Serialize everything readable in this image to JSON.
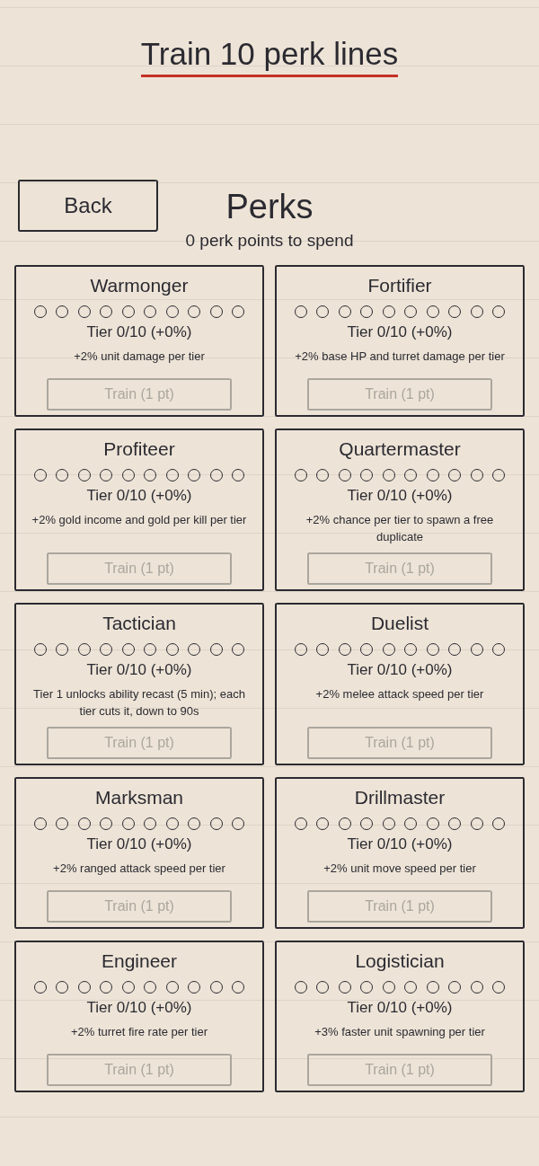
{
  "title": "Train 10 perk lines",
  "back_button": {
    "label": "Back"
  },
  "heading": "Perks",
  "points_text": "0 perk points to spend",
  "perks": [
    {
      "name": "Warmonger",
      "stars": 0,
      "tier": "Tier 0/10 (+0%)",
      "description": "+2% unit damage per tier",
      "train_button": {
        "label": "Train (1 pt)",
        "disabled": true
      }
    },
    {
      "name": "Fortifier",
      "stars": 0,
      "tier": "Tier 0/10 (+0%)",
      "description": "+2% base HP and turret damage per tier",
      "train_button": {
        "label": "Train (1 pt)",
        "disabled": true
      }
    },
    {
      "name": "Profiteer",
      "stars": 0,
      "tier": "Tier 0/10 (+0%)",
      "description": "+2% gold income and gold per kill per tier",
      "train_button": {
        "label": "Train (1 pt)",
        "disabled": true
      }
    },
    {
      "name": "Quartermaster",
      "stars": 0,
      "tier": "Tier 0/10 (+0%)",
      "description": "+2% chance per tier to spawn a free duplicate",
      "train_button": {
        "label": "Train (1 pt)",
        "disabled": true
      }
    },
    {
      "name": "Tactician",
      "stars": 0,
      "tier": "Tier 0/10 (+0%)",
      "description": "Tier 1 unlocks ability recast (5 min); each tier cuts it, down to 90s",
      "train_button": {
        "label": "Train (1 pt)",
        "disabled": true
      }
    },
    {
      "name": "Duelist",
      "stars": 0,
      "tier": "Tier 0/10 (+0%)",
      "description": "+2% melee attack speed per tier",
      "train_button": {
        "label": "Train (1 pt)",
        "disabled": true
      }
    },
    {
      "name": "Marksman",
      "stars": 0,
      "tier": "Tier 0/10 (+0%)",
      "description": "+2% ranged attack speed per tier",
      "train_button": {
        "label": "Train (1 pt)",
        "disabled": true
      }
    },
    {
      "name": "Drillmaster",
      "stars": 0,
      "tier": "Tier 0/10 (+0%)",
      "description": "+2% unit move speed per tier",
      "train_button": {
        "label": "Train (1 pt)",
        "disabled": true
      }
    },
    {
      "name": "Engineer",
      "stars": 0,
      "tier": "Tier 0/10 (+0%)",
      "description": "+2% turret fire rate per tier",
      "train_button": {
        "label": "Train (1 pt)",
        "disabled": true
      }
    },
    {
      "name": "Logistician",
      "stars": 0,
      "tier": "Tier 0/10 (+0%)",
      "description": "+3% faster unit spawning per tier",
      "train_button": {
        "label": "Train (1 pt)",
        "disabled": true
      }
    }
  ]
}
